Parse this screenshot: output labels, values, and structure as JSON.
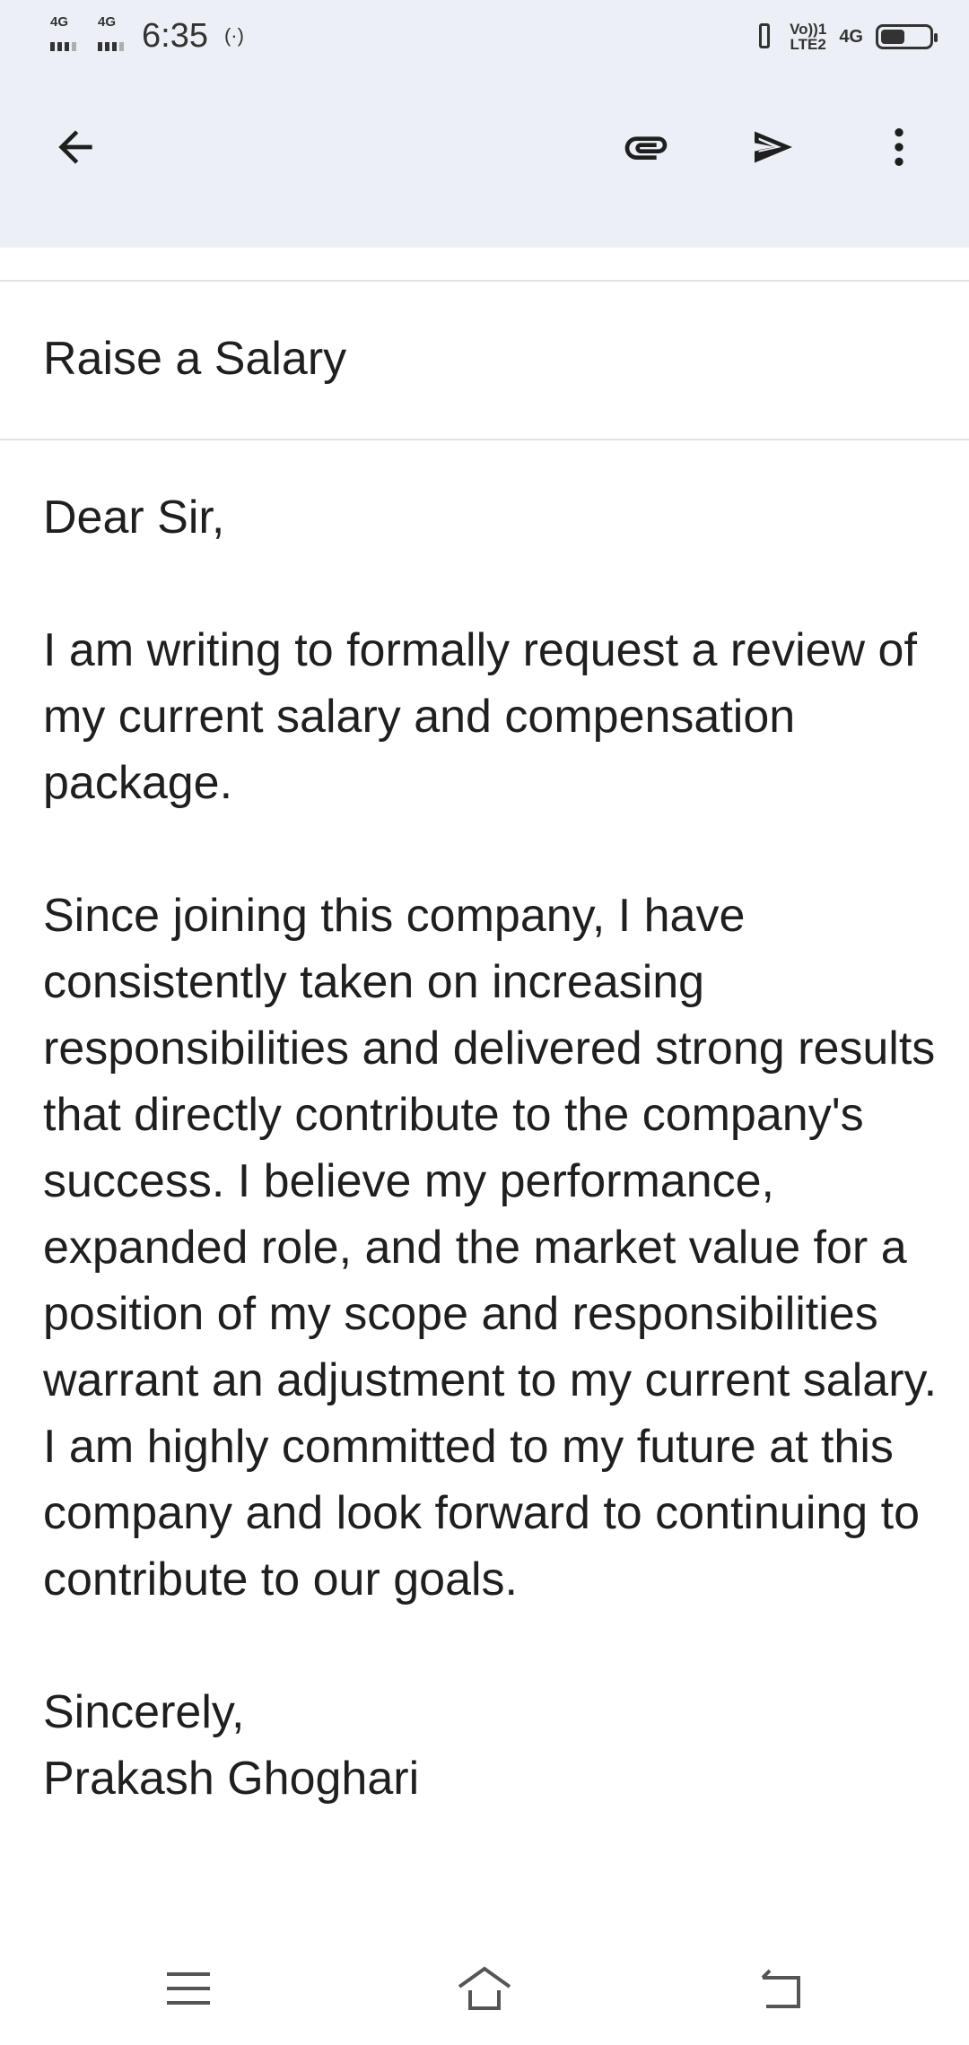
{
  "status_bar": {
    "sim1_network": "4G",
    "sim2_network": "4G",
    "time": "6:35",
    "volte_line1": "Vo))1",
    "volte_line2": "LTE2",
    "network_type": "4G"
  },
  "toolbar": {
    "back_icon": "arrow-back-icon",
    "attach_icon": "paperclip-icon",
    "send_icon": "send-icon",
    "more_icon": "more-vertical-icon"
  },
  "email": {
    "subject": "Raise a Salary",
    "greeting": "Dear Sir,",
    "paragraph1": "I am writing to formally request a review of my current salary and compensation package.",
    "paragraph2": "Since joining this company, I have consistently taken on increasing responsibilities and delivered strong results that directly contribute to the company's success. I believe my performance, expanded role, and the market value for a position of my scope and responsibilities warrant an adjustment to my current salary. I am highly committed to my future at this company and look forward to continuing to contribute to our goals.",
    "closing": "Sincerely,",
    "signature": "Prakash Ghoghari"
  },
  "nav_bar": {
    "menu_icon": "menu-icon",
    "home_icon": "home-icon",
    "back_icon": "back-icon"
  },
  "colors": {
    "app_bar": "#ecf0f6",
    "background": "#ffffff",
    "text": "#1f1f1f",
    "divider": "#e3e3e3"
  }
}
